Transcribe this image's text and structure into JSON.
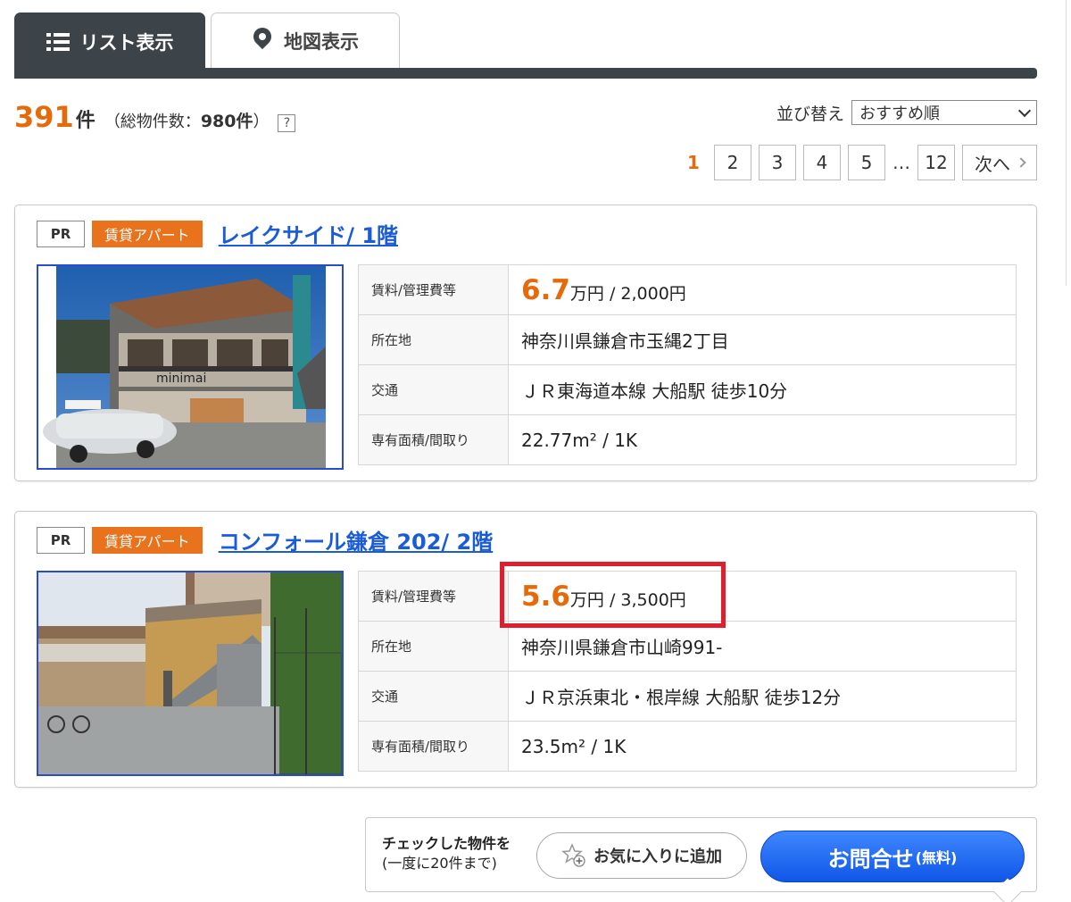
{
  "tabs": {
    "list_label": "リスト表示",
    "map_label": "地図表示"
  },
  "summary": {
    "count": "391",
    "count_unit": "件",
    "total_text": "（総物件数：",
    "total_count": "980件",
    "total_close": "）",
    "help_label": "?"
  },
  "sort": {
    "label": "並び替え",
    "selected": "おすすめ順"
  },
  "pagination": {
    "current": "1",
    "pages": [
      "2",
      "3",
      "4",
      "5"
    ],
    "ellipsis": "…",
    "last": "12",
    "next_label": "次へ"
  },
  "listings": [
    {
      "pr": "PR",
      "type": "賃貸アパート",
      "title": "レイクサイド/ 1階",
      "rent_label": "賃料/管理費等",
      "rent": "6.7",
      "rent_unit": "万円 / 2,000円",
      "address_label": "所在地",
      "address": "神奈川県鎌倉市玉縄2丁目",
      "access_label": "交通",
      "access": "ＪＲ東海道本線 大船駅 徒歩10分",
      "area_label": "専有面積/間取り",
      "area": "22.77m² / 1K",
      "photo_sign": "minimai"
    },
    {
      "pr": "PR",
      "type": "賃貸アパート",
      "title": "コンフォール鎌倉 202/ 2階",
      "rent_label": "賃料/管理費等",
      "rent": "5.6",
      "rent_unit": "万円 / 3,500円",
      "address_label": "所在地",
      "address": "神奈川県鎌倉市山崎991-",
      "access_label": "交通",
      "access": "ＪＲ京浜東北・根岸線 大船駅 徒歩12分",
      "area_label": "専有面積/間取り",
      "area": "23.5m² / 1K"
    }
  ],
  "action_bar": {
    "line1": "チェックした物件を",
    "line2": "(一度に20件まで)",
    "favorite_label": "お気に入りに追加",
    "inquiry_label": "お問合せ",
    "inquiry_note": "(無料)"
  },
  "colors": {
    "accent_orange": "#e56a0a",
    "tab_dark": "#3c4449",
    "link_blue": "#1a5bd6",
    "highlight_red": "#e01f2e",
    "button_blue": "#1565f0"
  }
}
